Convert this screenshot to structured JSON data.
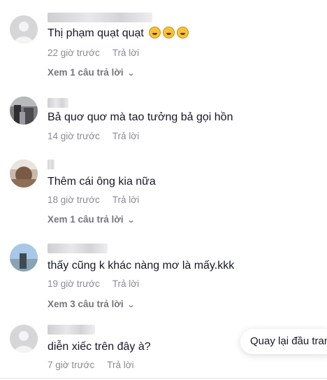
{
  "comments": [
    {
      "text": "Thị phạm quạt quạt",
      "emojis": [
        "rofl-emoji",
        "rofl-emoji",
        "rofl-emoji"
      ],
      "time": "22 giờ trước",
      "reply": "Trả lời",
      "view_replies": "Xem 1 câu trả lời"
    },
    {
      "text": "Bả quơ quơ mà tao tưởng bả gọi hồn",
      "time": "14 giờ trước",
      "reply": "Trả lời"
    },
    {
      "text": "Thêm cái ông kia nữa",
      "time": "18 giờ trước",
      "reply": "Trả lời",
      "view_replies": "Xem 1 câu trả lời"
    },
    {
      "text": "thấy cũng k khác nàng mơ là mấy.kkk",
      "time": "19 giờ trước",
      "reply": "Trả lời",
      "view_replies": "Xem 3 câu trả lời"
    },
    {
      "text": "diễn xiếc trên đây à?",
      "time": "7 giờ trước",
      "reply": "Trả lời"
    }
  ],
  "back_to_top": "Quay lại đầu trang",
  "icons": {
    "chevron": "chevron-down-icon",
    "avatar_default": "default-avatar-icon"
  }
}
